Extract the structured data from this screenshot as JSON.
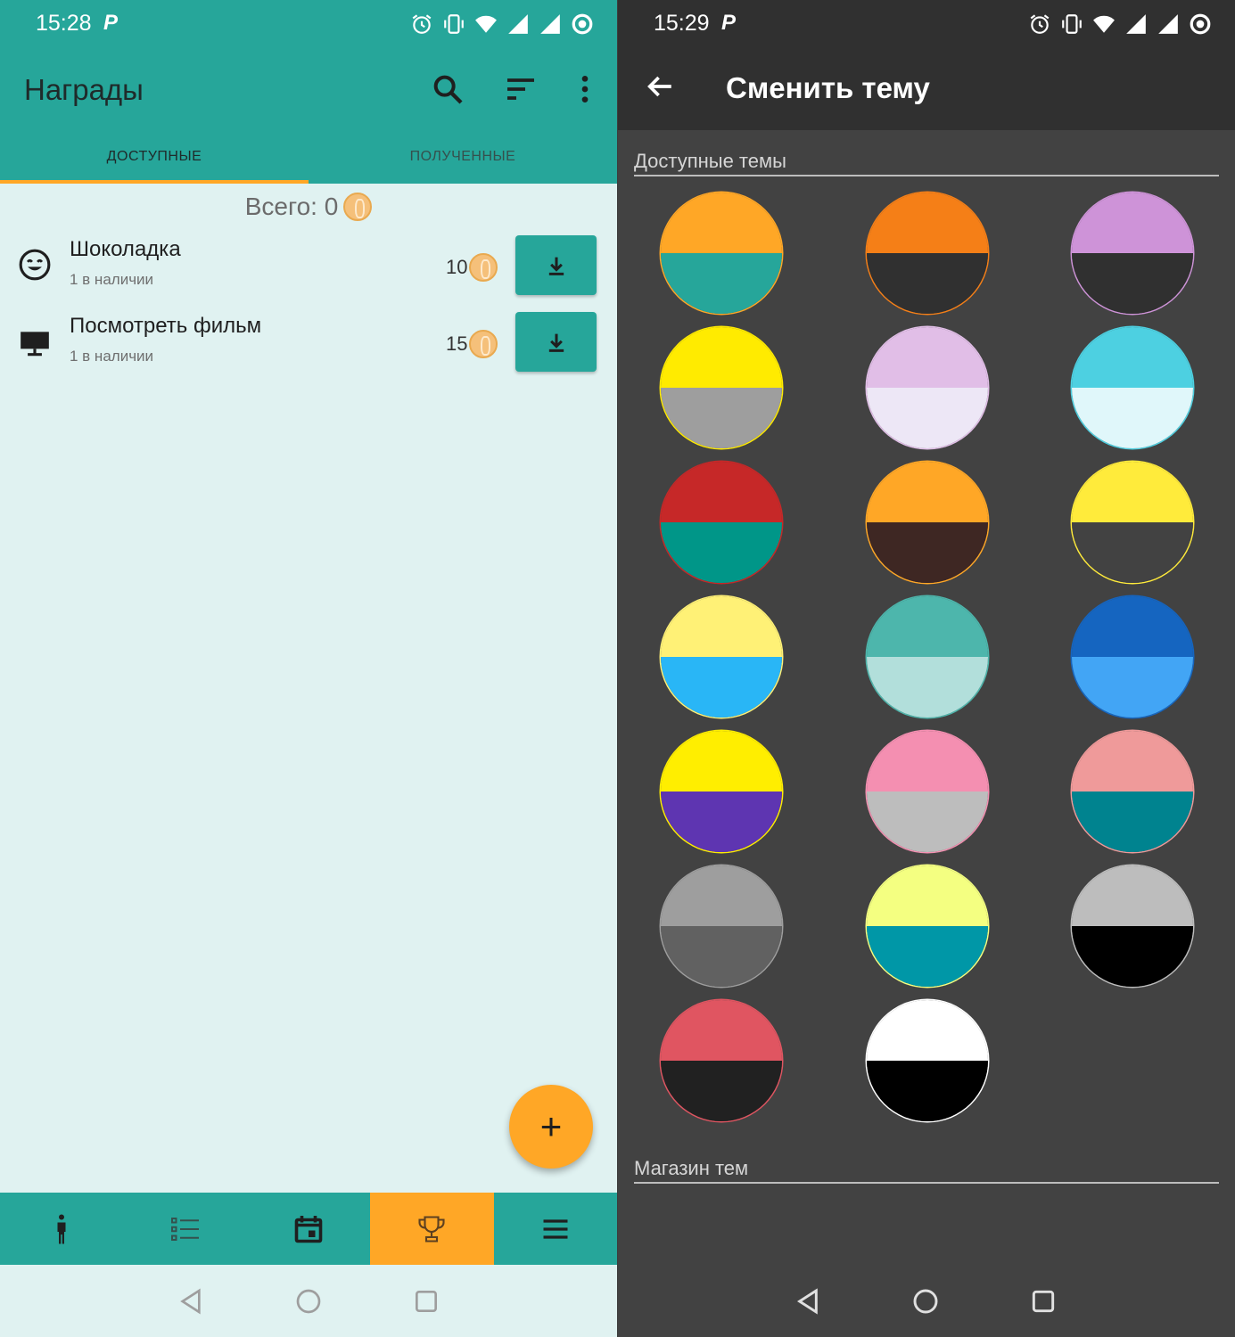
{
  "left": {
    "status": {
      "time": "15:28",
      "p": "P"
    },
    "appbar": {
      "title": "Награды"
    },
    "tabs": [
      {
        "label": "ДОСТУПНЫЕ"
      },
      {
        "label": "ПОЛУЧЕННЫЕ"
      }
    ],
    "total": "Всего: 0",
    "rewards": [
      {
        "title": "Шоколадка",
        "subtitle": "1 в наличии",
        "price": "10",
        "icon": "smiley-icon"
      },
      {
        "title": "Посмотреть фильм",
        "subtitle": "1 в наличии",
        "price": "15",
        "icon": "monitor-icon"
      }
    ],
    "fab": "+",
    "bottom_nav": [
      "person-icon",
      "list-icon",
      "calendar-icon",
      "trophy-icon",
      "menu-icon"
    ],
    "colors": {
      "primary": "#26a69a",
      "accent": "#ffa726",
      "background": "#e0f2f1"
    }
  },
  "right": {
    "status": {
      "time": "15:29",
      "p": "P"
    },
    "title": "Сменить тему",
    "section_available": "Доступные темы",
    "section_store": "Магазин тем",
    "themes": [
      {
        "top": "#ffa726",
        "bottom": "#26a69a"
      },
      {
        "top": "#f57f17",
        "bottom": "#303030"
      },
      {
        "top": "#ce93d8",
        "bottom": "#303030"
      },
      {
        "top": "#ffeb00",
        "bottom": "#9e9e9e"
      },
      {
        "top": "#e1bee7",
        "bottom": "#ede7f6"
      },
      {
        "top": "#4dd0e1",
        "bottom": "#e0f7fa"
      },
      {
        "top": "#c62828",
        "bottom": "#009688"
      },
      {
        "top": "#ffa726",
        "bottom": "#3e2723"
      },
      {
        "top": "#ffeb3b",
        "bottom": "#424242"
      },
      {
        "top": "#fff176",
        "bottom": "#29b6f6"
      },
      {
        "top": "#4db6ac",
        "bottom": "#b2dfdb"
      },
      {
        "top": "#1565c0",
        "bottom": "#42a5f5"
      },
      {
        "top": "#ffee00",
        "bottom": "#5e35b1"
      },
      {
        "top": "#f48fb1",
        "bottom": "#bdbdbd"
      },
      {
        "top": "#ef9a9a",
        "bottom": "#00838f"
      },
      {
        "top": "#9e9e9e",
        "bottom": "#616161"
      },
      {
        "top": "#f4ff81",
        "bottom": "#0097a7"
      },
      {
        "top": "#bdbdbd",
        "bottom": "#000000"
      },
      {
        "top": "#e05561",
        "bottom": "#212121"
      },
      {
        "top": "#ffffff",
        "bottom": "#000000"
      }
    ],
    "colors": {
      "appbar": "#303030",
      "background": "#424242"
    }
  }
}
